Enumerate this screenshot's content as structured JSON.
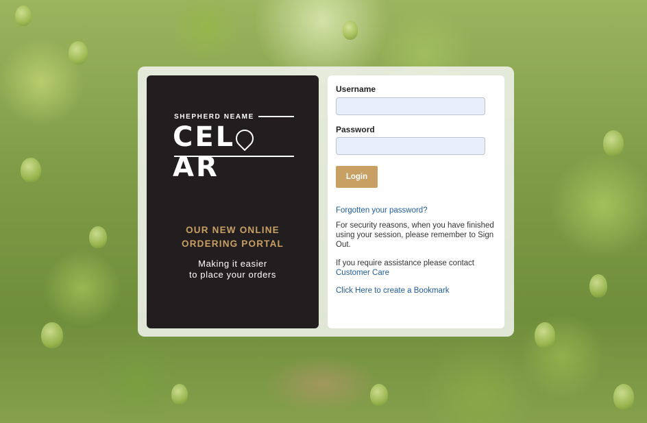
{
  "promo": {
    "brand_top": "SHEPHERD NEAME",
    "brand_main_left": "CEL",
    "brand_main_right": "AR",
    "headline_line1": "OUR NEW ONLINE",
    "headline_line2": "ORDERING PORTAL",
    "sub_line1": "Making it easier",
    "sub_line2": "to place your orders"
  },
  "login": {
    "username_label": "Username",
    "username_value": "",
    "password_label": "Password",
    "password_value": "",
    "login_button": "Login",
    "forgot_link": "Forgotten your password?",
    "security_note": "For security reasons, when you have finished using your session, please remember to Sign Out.",
    "assistance_text": "If you require assistance please contact",
    "customer_care_link": "Customer Care",
    "bookmark_link": "Click Here to create a Bookmark"
  },
  "colors": {
    "accent_gold": "#c9a064",
    "promo_bg": "#221e1f",
    "link_blue": "#1f5c99",
    "input_bg": "#e8effb"
  }
}
